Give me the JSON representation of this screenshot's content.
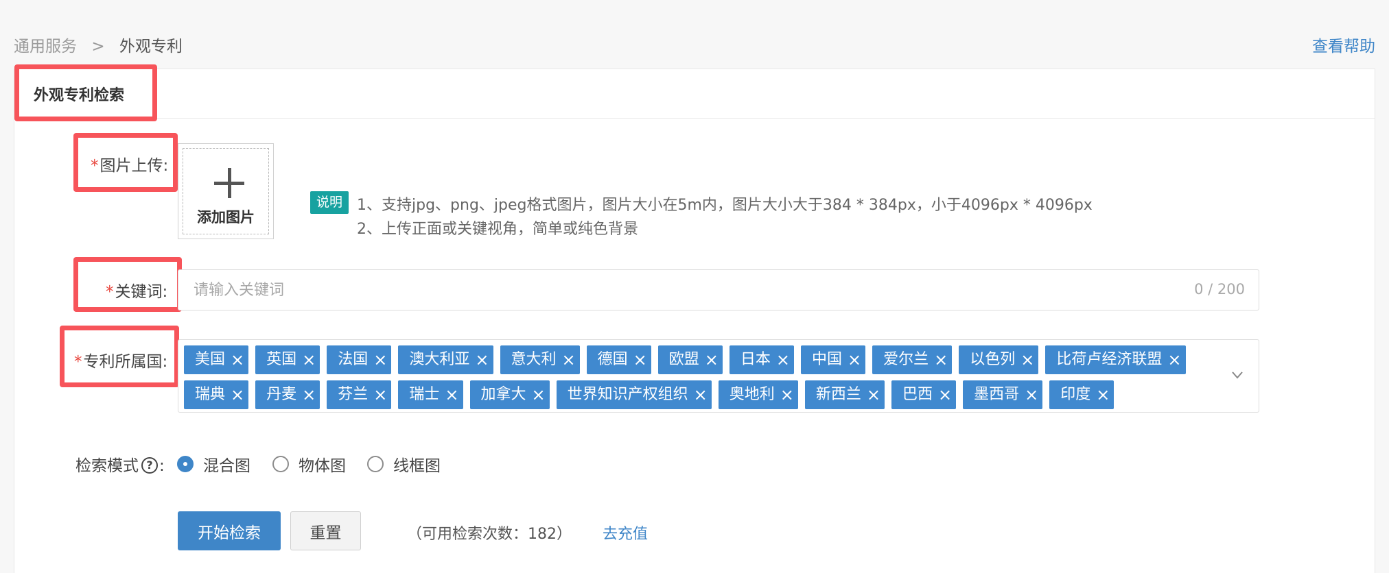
{
  "breadcrumb": {
    "parent": "通用服务",
    "separator": ">",
    "current": "外观专利"
  },
  "help_link": "查看帮助",
  "card": {
    "title": "外观专利检索"
  },
  "upload": {
    "label": "图片上传",
    "required_mark": "*",
    "colon": ":",
    "button_text": "添加图片",
    "icon": "plus-icon"
  },
  "notes": {
    "badge": "说明",
    "lines": [
      "1、支持jpg、png、jpeg格式图片，图片大小在5m内，图片大小大于384 * 384px，小于4096px * 4096px",
      "2、上传正面或关键视角，简单或纯色背景"
    ]
  },
  "keyword": {
    "label": "关键词",
    "required_mark": "*",
    "colon": ":",
    "placeholder": "请输入关键词",
    "value": "",
    "counter": "0 / 200"
  },
  "country": {
    "label": "专利所属国",
    "required_mark": "*",
    "colon": ":",
    "remove_glyph": "×",
    "selected": [
      "美国",
      "英国",
      "法国",
      "澳大利亚",
      "意大利",
      "德国",
      "欧盟",
      "日本",
      "中国",
      "爱尔兰",
      "以色列",
      "比荷卢经济联盟",
      "瑞典",
      "丹麦",
      "芬兰",
      "瑞士",
      "加拿大",
      "世界知识产权组织",
      "奥地利",
      "新西兰",
      "巴西",
      "墨西哥",
      "印度"
    ],
    "dropdown_icon": "chevron-down-icon"
  },
  "search_mode": {
    "label": "检索模式",
    "help_glyph": "?",
    "colon": ":",
    "options": [
      "混合图",
      "物体图",
      "线框图"
    ],
    "selected": "混合图"
  },
  "actions": {
    "search_label": "开始检索",
    "reset_label": "重置",
    "quota_text": "（可用检索次数：182）",
    "recharge_label": "去充值"
  },
  "colors": {
    "accent": "#3f86c8",
    "tag": "#4089cf",
    "badge": "#17a2a0",
    "highlight": "#f7545a",
    "required": "#e8473f"
  }
}
